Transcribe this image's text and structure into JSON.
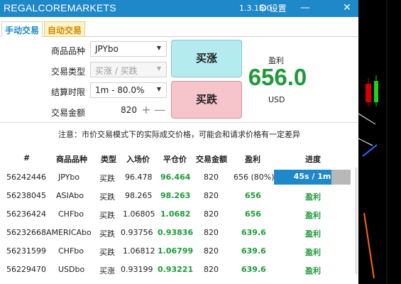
{
  "window": {
    "title": "REGALCOREMARKETS",
    "version": "1.3.15.0",
    "settings_label": "设置",
    "minimize": "—",
    "close": "✕"
  },
  "tabs": [
    {
      "label": "手动交易",
      "active": true
    },
    {
      "label": "自动交易",
      "active": false
    }
  ],
  "form": {
    "product_label": "商品品种",
    "product_value": "JPYbo",
    "type_label": "交易类型",
    "type_value": "买涨 / 买跌",
    "period_label": "结算时限",
    "period_value": "1m - 80.0%",
    "amount_label": "交易金额",
    "amount_value": "820",
    "plus": "+",
    "minus": "—"
  },
  "actions": {
    "rise_label": "买涨",
    "fall_label": "买跌"
  },
  "profit": {
    "label": "盈利",
    "value": "656.0",
    "unit": "USD"
  },
  "notice": "注意：市价交易模式下的实际成交价格，可能会和请求价格有一定差异",
  "table": {
    "headers": [
      "#",
      "商品品种",
      "类型",
      "入场价",
      "平仓价",
      "交易金额",
      "盈利",
      "进度"
    ],
    "rows": [
      {
        "id": "56242446",
        "product": "JPYbo",
        "type": "买跌",
        "entry": "96.478",
        "close": "96.464",
        "amount": "820",
        "profit": "656 (80%)",
        "progress": "45s / 1m",
        "progress_fraction": 0.75
      },
      {
        "id": "56238045",
        "product": "ASIAbo",
        "type": "买跌",
        "entry": "98.265",
        "close": "98.263",
        "amount": "820",
        "profit": "656",
        "progress": "盈利"
      },
      {
        "id": "56236424",
        "product": "CHFbo",
        "type": "买跌",
        "entry": "1.06805",
        "close": "1.0682",
        "amount": "820",
        "profit": "656",
        "progress": "盈利"
      },
      {
        "id": "56232668",
        "product": "AMERICAbo",
        "type": "买跌",
        "entry": "0.93756",
        "close": "0.93836",
        "amount": "820",
        "profit": "639.6",
        "progress": "盈利"
      },
      {
        "id": "56231599",
        "product": "CHFbo",
        "type": "买跌",
        "entry": "1.06812",
        "close": "1.06799",
        "amount": "820",
        "profit": "639.6",
        "progress": "盈利"
      },
      {
        "id": "56229470",
        "product": "USDbo",
        "type": "买涨",
        "entry": "0.93199",
        "close": "0.93221",
        "amount": "820",
        "profit": "639.6",
        "progress": "盈利"
      }
    ]
  },
  "colors": {
    "titlebar": "#1f88c8",
    "profit_green": "#1e9a3a",
    "rise_button": "#b4ebef",
    "fall_button": "#f6c4cb",
    "progress_fill": "#1f88c8"
  }
}
